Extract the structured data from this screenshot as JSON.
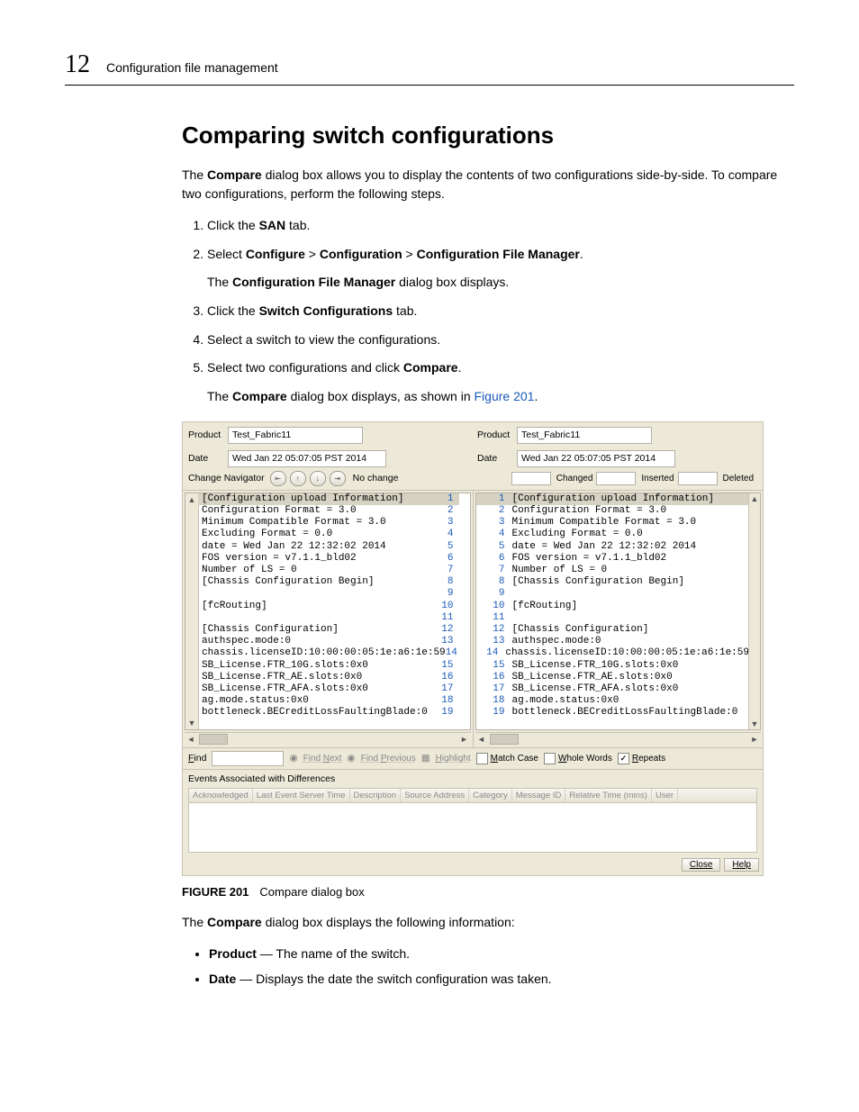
{
  "page": {
    "number": "12",
    "running_title": "Configuration file management"
  },
  "section_title": "Comparing switch configurations",
  "intro_before_bold": "The ",
  "intro_bold": "Compare",
  "intro_after_bold": " dialog box allows you to display the contents of two configurations side-by-side. To compare two configurations, perform the following steps.",
  "steps": {
    "s1a": "Click the ",
    "s1b": "SAN",
    "s1c": " tab.",
    "s2a": "Select ",
    "s2b": "Configure",
    "s2c": " > ",
    "s2d": "Configuration",
    "s2e": " > ",
    "s2f": "Configuration File Manager",
    "s2g": ".",
    "s2sub_a": "The ",
    "s2sub_b": "Configuration File Manager",
    "s2sub_c": " dialog box displays.",
    "s3a": "Click the ",
    "s3b": "Switch Configurations",
    "s3c": " tab.",
    "s4": "Select a switch to view the configurations.",
    "s5a": "Select two configurations and click ",
    "s5b": "Compare",
    "s5c": ".",
    "s5sub_a": "The ",
    "s5sub_b": "Compare",
    "s5sub_c": " dialog box displays, as shown in ",
    "s5sub_link": "Figure 201",
    "s5sub_d": "."
  },
  "dialog": {
    "product_label": "Product",
    "date_label": "Date",
    "product_value": "Test_Fabric11",
    "date_value": "Wed Jan 22 05:07:05 PST 2014",
    "change_nav_label": "Change Navigator",
    "no_change_label": "No change",
    "legend_changed": "Changed",
    "legend_inserted": "Inserted",
    "legend_deleted": "Deleted",
    "find_label": "Find",
    "find_next": "Find Next",
    "find_prev": "Find Previous",
    "highlight": "Highlight",
    "match_case": "Match Case",
    "whole_words": "Whole Words",
    "repeats": "Repeats",
    "events_header": "Events Associated with Differences",
    "close_btn": "Close",
    "help_btn": "Help",
    "event_cols": [
      "Acknowledged",
      "Last Event Server Time",
      "Description",
      "Source Address",
      "Category",
      "Message ID",
      "Relative Time (mins)",
      "User"
    ],
    "code": [
      "[Configuration upload Information]",
      "Configuration Format = 3.0",
      "Minimum Compatible Format = 3.0",
      "Excluding Format = 0.0",
      "date = Wed Jan 22 12:32:02 2014",
      "FOS version = v7.1.1_bld02",
      "Number of LS = 0",
      "[Chassis Configuration Begin]",
      "",
      "[fcRouting]",
      "",
      "[Chassis Configuration]",
      "authspec.mode:0",
      "chassis.licenseID:10:00:00:05:1e:a6:1e:59",
      "SB_License.FTR_10G.slots:0x0",
      "SB_License.FTR_AE.slots:0x0",
      "SB_License.FTR_AFA.slots:0x0",
      "ag.mode.status:0x0",
      "bottleneck.BECreditLossFaultingBlade:0"
    ]
  },
  "figure": {
    "label": "FIGURE 201",
    "caption": "Compare dialog box"
  },
  "post_figure": {
    "p_a": "The ",
    "p_b": "Compare",
    "p_c": " dialog box displays the following information:",
    "b1a": "Product",
    "b1b": " — The name of the switch.",
    "b2a": "Date",
    "b2b": " — Displays the date the switch configuration was taken."
  }
}
